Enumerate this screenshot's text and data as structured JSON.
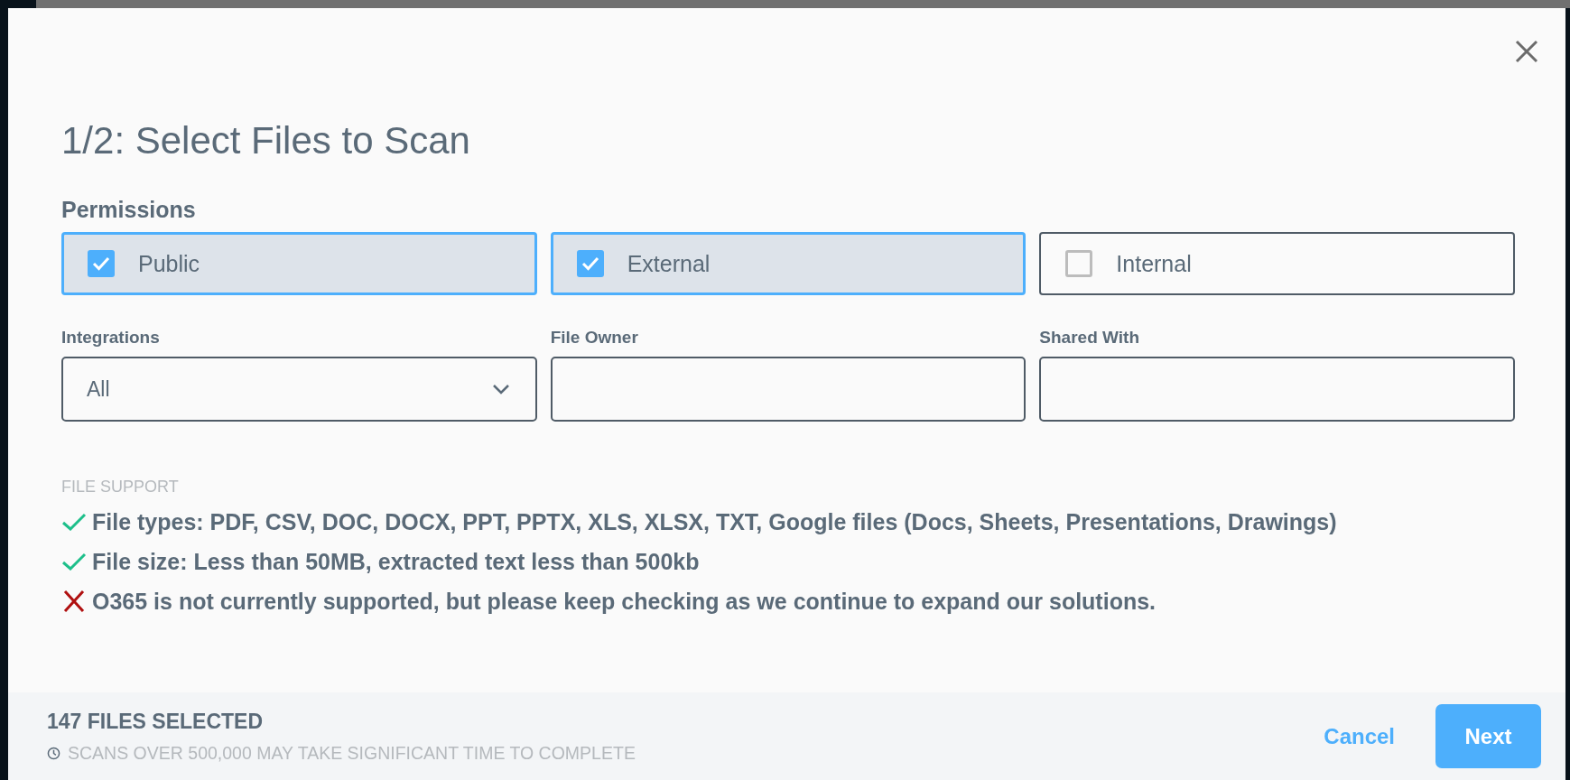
{
  "dialog": {
    "title": "1/2: Select Files to Scan",
    "permissions": {
      "label": "Permissions",
      "options": [
        {
          "label": "Public",
          "checked": true
        },
        {
          "label": "External",
          "checked": true
        },
        {
          "label": "Internal",
          "checked": false
        }
      ]
    },
    "filters": [
      {
        "kind": "dropdown",
        "label": "Integrations",
        "value": "All"
      },
      {
        "kind": "text",
        "label": "File Owner"
      },
      {
        "kind": "text",
        "label": "Shared With"
      }
    ],
    "file_support": {
      "heading": "FILE SUPPORT",
      "items": [
        {
          "supported": true,
          "text": "File types: PDF, CSV, DOC, DOCX, PPT, PPTX, XLS, XLSX, TXT, Google files (Docs, Sheets, Presentations, Drawings)"
        },
        {
          "supported": true,
          "text": "File size: Less than 50MB, extracted text less than 500kb"
        },
        {
          "supported": false,
          "text": "O365 is not currently supported, but please keep checking as we continue to expand our solutions."
        }
      ]
    },
    "footer": {
      "selected_count": "147 FILES SELECTED",
      "hint": "SCANS OVER 500,000 MAY TAKE SIGNIFICANT TIME TO COMPLETE",
      "buttons": [
        {
          "kind": "link",
          "label": "Cancel"
        },
        {
          "kind": "primary",
          "label": "Next"
        }
      ]
    }
  }
}
